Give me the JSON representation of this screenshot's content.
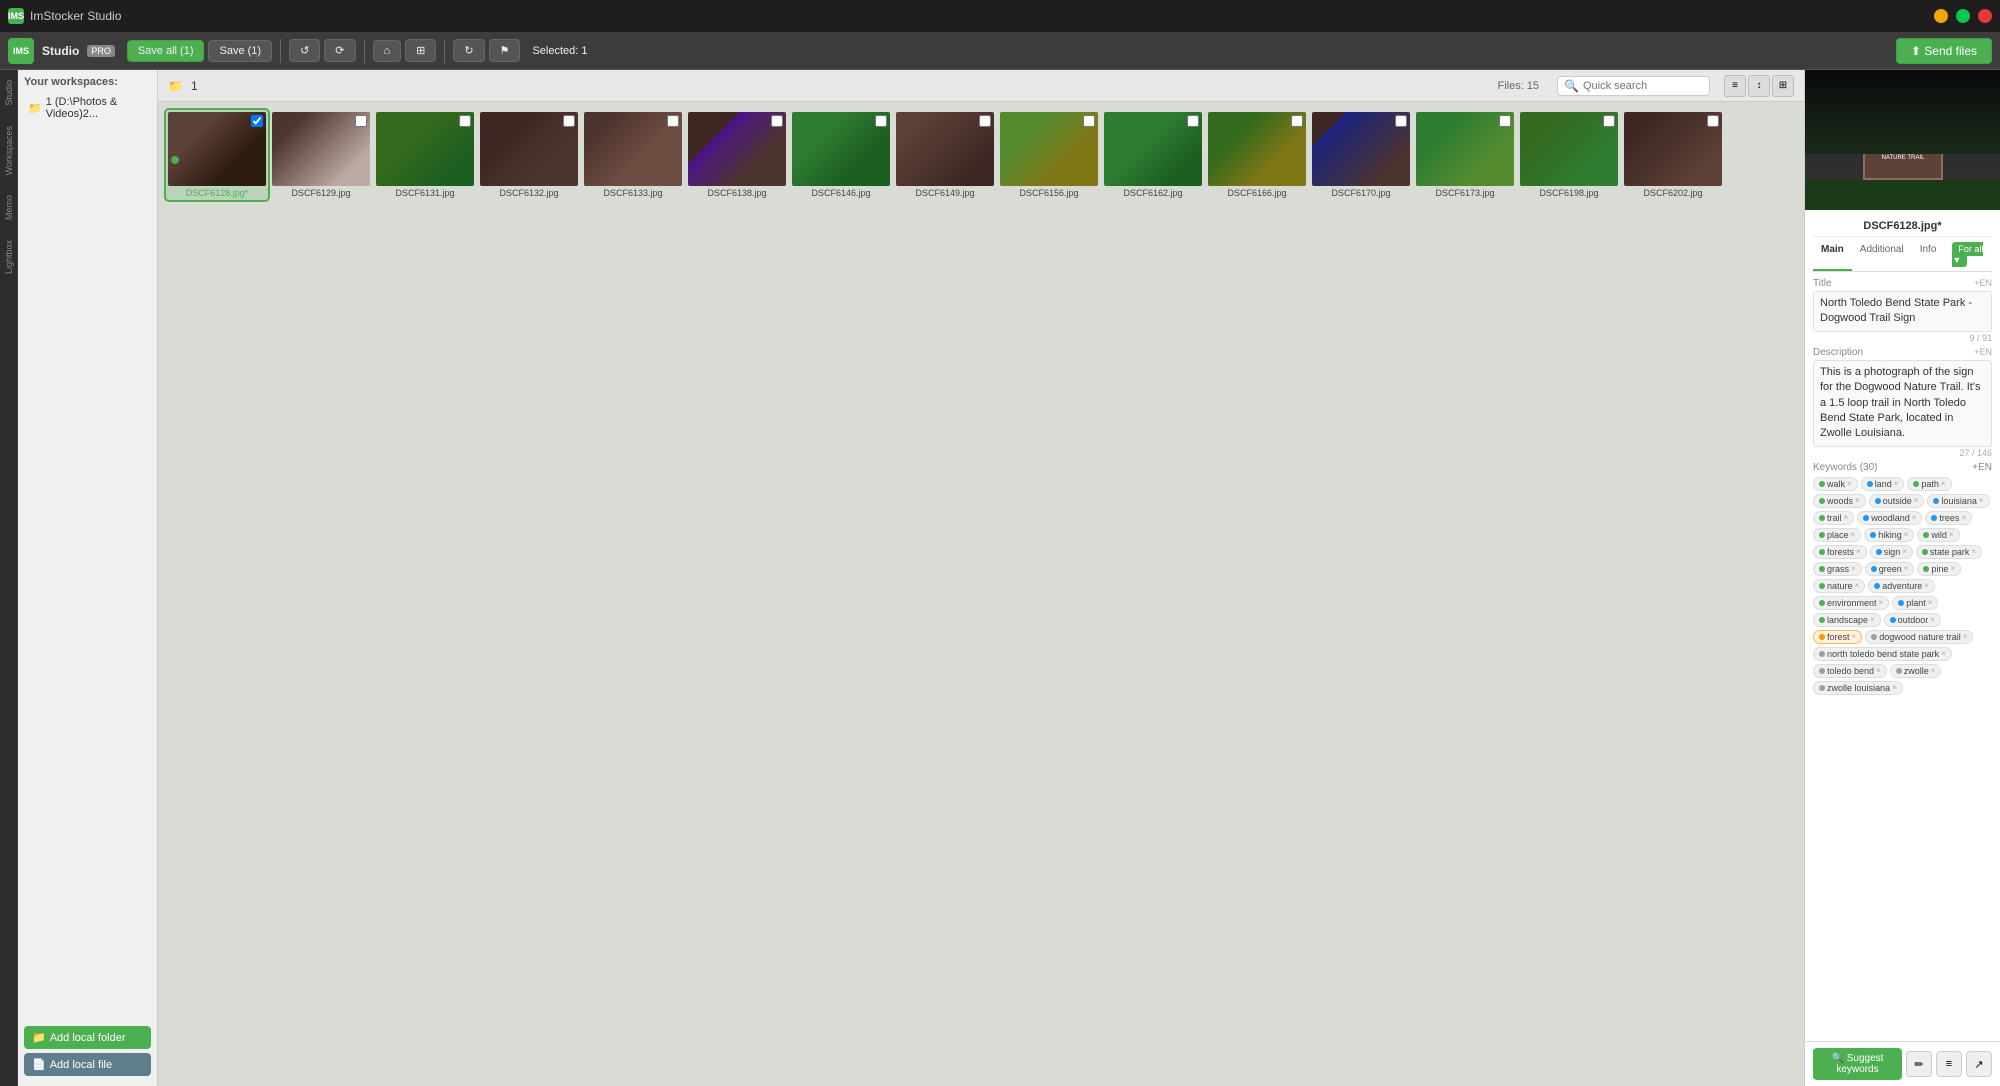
{
  "app": {
    "title": "ImStocker Studio",
    "icon_label": "IMS"
  },
  "titlebar": {
    "title": "ImStocker Studio"
  },
  "toolbar": {
    "save_all_label": "Save all (1)",
    "save_label": "Save (1)",
    "selected_label": "Selected: 1",
    "send_files_label": "⬆ Send files"
  },
  "left_sidebar": {
    "items": [
      {
        "label": "Studio",
        "id": "studio"
      },
      {
        "label": "Your workspaces:",
        "id": "workspaces"
      },
      {
        "label": "Lightbox",
        "id": "lightbox"
      },
      {
        "label": "Memo",
        "id": "memo"
      }
    ]
  },
  "workspaces": {
    "title": "Your workspaces:",
    "items": [
      {
        "label": "1 (D:\\Photos & Videos)2..."
      }
    ],
    "add_folder_btn": "Add local folder",
    "add_file_btn": "Add local file"
  },
  "browser": {
    "breadcrumb": "1",
    "files_count": "Files: 15",
    "search_placeholder": "Quick search",
    "thumbnails": [
      {
        "name": "DSCF6128.jpg*",
        "class": "t1",
        "selected": true
      },
      {
        "name": "DSCF6129.jpg",
        "class": "t2"
      },
      {
        "name": "DSCF6131.jpg",
        "class": "t3"
      },
      {
        "name": "DSCF6132.jpg",
        "class": "t4"
      },
      {
        "name": "DSCF6133.jpg",
        "class": "t5"
      },
      {
        "name": "DSCF6138.jpg",
        "class": "t6"
      },
      {
        "name": "DSCF6146.jpg",
        "class": "t7"
      },
      {
        "name": "DSCF6149.jpg",
        "class": "t8"
      },
      {
        "name": "DSCF6156.jpg",
        "class": "t9"
      },
      {
        "name": "DSCF6162.jpg",
        "class": "t10"
      },
      {
        "name": "DSCF6166.jpg",
        "class": "t11"
      },
      {
        "name": "DSCF6170.jpg",
        "class": "t13"
      },
      {
        "name": "DSCF6173.jpg",
        "class": "t14"
      },
      {
        "name": "DSCF6198.jpg",
        "class": "t15"
      },
      {
        "name": "DSCF6202.jpg",
        "class": "t18"
      }
    ]
  },
  "right_panel": {
    "filename": "DSCF6128.jpg*",
    "tabs": [
      "Main",
      "Additional",
      "Info"
    ],
    "for_all_label": "For all ▼",
    "title_label": "Title",
    "title_edit": "+EN",
    "title_char_count": "9 / 91",
    "title_value": "North Toledo Bend State Park - Dogwood Trail Sign",
    "description_label": "Description",
    "description_edit": "+EN",
    "description_char_count": "27 / 146",
    "description_value": "This is a photograph of the sign for the Dogwood Nature Trail. It's a 1.5 loop trail in North Toledo Bend State Park, located in Zwolle Louisiana.",
    "keywords_label": "Keywords",
    "keywords_count": "(30)",
    "keywords_edit": "+EN",
    "keywords": [
      {
        "text": "walk",
        "color": "#4CAF50"
      },
      {
        "text": "land",
        "color": "#2196F3"
      },
      {
        "text": "path",
        "color": "#4CAF50"
      },
      {
        "text": "woods",
        "color": "#4CAF50"
      },
      {
        "text": "outside",
        "color": "#2196F3"
      },
      {
        "text": "louisiana",
        "color": "#2196F3"
      },
      {
        "text": "trail",
        "color": "#4CAF50"
      },
      {
        "text": "woodland",
        "color": "#2196F3"
      },
      {
        "text": "trees",
        "color": "#2196F3"
      },
      {
        "text": "place",
        "color": "#4CAF50"
      },
      {
        "text": "hiking",
        "color": "#2196F3"
      },
      {
        "text": "wild",
        "color": "#4CAF50"
      },
      {
        "text": "forests",
        "color": "#4CAF50"
      },
      {
        "text": "sign",
        "color": "#2196F3"
      },
      {
        "text": "state park",
        "color": "#4CAF50"
      },
      {
        "text": "grass",
        "color": "#4CAF50"
      },
      {
        "text": "green",
        "color": "#2196F3"
      },
      {
        "text": "pine",
        "color": "#4CAF50"
      },
      {
        "text": "nature",
        "color": "#4CAF50"
      },
      {
        "text": "adventure",
        "color": "#2196F3"
      },
      {
        "text": "environment",
        "color": "#4CAF50"
      },
      {
        "text": "plant",
        "color": "#2196F3"
      },
      {
        "text": "landscape",
        "color": "#4CAF50"
      },
      {
        "text": "outdoor",
        "color": "#2196F3"
      },
      {
        "text": "forest",
        "color": "#FF9800",
        "highlighted": true
      },
      {
        "text": "dogwood nature trail",
        "color": "#9E9E9E"
      },
      {
        "text": "north toledo bend state park",
        "color": "#9E9E9E"
      },
      {
        "text": "toledo bend",
        "color": "#9E9E9E"
      },
      {
        "text": "zwolle",
        "color": "#9E9E9E"
      },
      {
        "text": "zwolle louisiana",
        "color": "#9E9E9E"
      }
    ],
    "suggest_btn": "🔍 Suggest keywords",
    "footer_icons": [
      "✏",
      "≡",
      "↗"
    ]
  }
}
